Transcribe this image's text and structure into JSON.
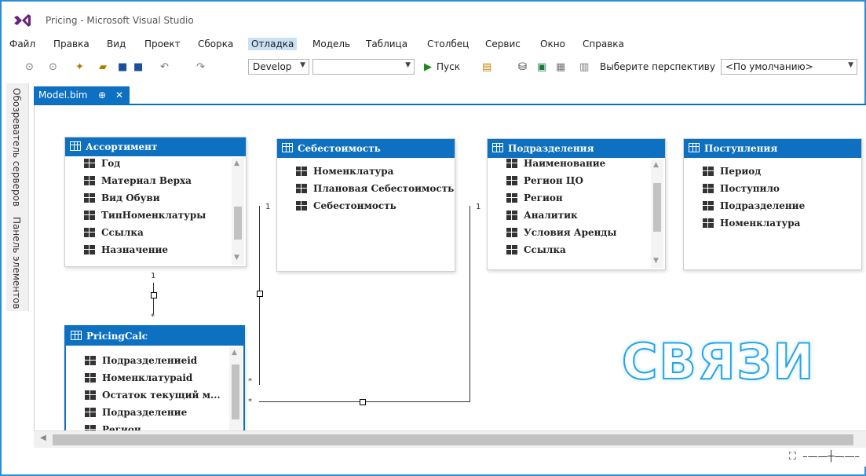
{
  "window": {
    "title": "Pricing - Microsoft Visual Studio"
  },
  "menu": [
    "Файл",
    "Правка",
    "Вид",
    "Проект",
    "Сборка",
    "Отладка",
    "Модель",
    "Таблица",
    "Столбец",
    "Сервис",
    "Окно",
    "Справка"
  ],
  "menu_active": "Отладка",
  "toolbar": {
    "config_value": "Develop",
    "platform_value": "",
    "run_label": "Пуск",
    "perspective_label": "Выберите перспективу",
    "perspective_value": "<По умолчанию>"
  },
  "side_tabs": [
    "Обозреватель серверов",
    "Панель элементов"
  ],
  "document_tab": {
    "label": "Model.bim",
    "pin": "⊕",
    "close": "✕"
  },
  "tables": [
    {
      "name": "Ассортимент",
      "columns": [
        "Год",
        "Материал Верха",
        "Вид Обуви",
        "ТипНоменклатуры",
        "Ссылка",
        "Назначение"
      ]
    },
    {
      "name": "Себестоимость",
      "columns": [
        "Номенклатура",
        "Плановая Себестоимость",
        "Себестоимость"
      ]
    },
    {
      "name": "Подразделения",
      "columns": [
        "Наименование",
        "Регион ЦО",
        "Регион",
        "Аналитик",
        "Условия Аренды",
        "Ссылка"
      ]
    },
    {
      "name": "Поступления",
      "columns": [
        "Период",
        "Поступило",
        "Подразделение",
        "Номенклатура"
      ]
    },
    {
      "name": "PricingCalc",
      "columns": [
        "Подразделениеid",
        "Номенклатураid",
        "Остаток текущий м...",
        "Подразделение",
        "Регион"
      ]
    }
  ],
  "relations": {
    "one": "1",
    "many": "*"
  },
  "watermark": "СВЯЗИ",
  "colors": {
    "accent": "#0e70c0",
    "frame": "#2a8fd6",
    "watermark_stroke": "#23a6e8"
  }
}
